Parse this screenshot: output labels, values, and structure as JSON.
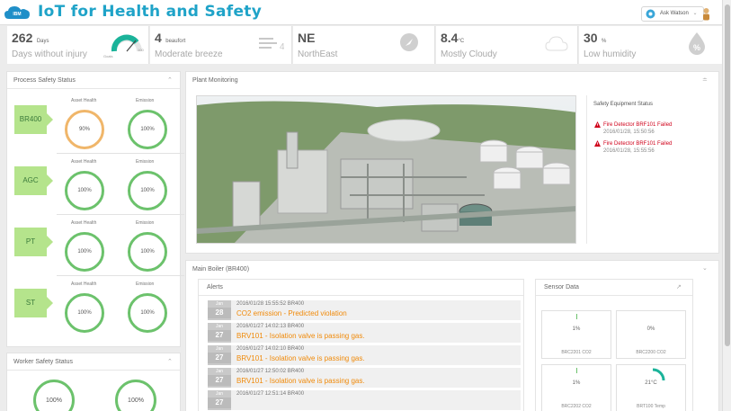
{
  "header": {
    "title": "IoT for Health and Safety",
    "logo_text": "IBM",
    "ask_watson": "Ask Watson"
  },
  "kpis": [
    {
      "value": "262",
      "unit": "Days",
      "label": "Days without injury",
      "icon": "gauge-icon",
      "gauge_max": "100",
      "gauge_label": "Goals"
    },
    {
      "value": "4",
      "unit": "beaufort",
      "label": "Moderate breeze",
      "icon": "wind-icon"
    },
    {
      "value": "NE",
      "unit": "",
      "label": "NorthEast",
      "icon": "compass-icon"
    },
    {
      "value": "8.4",
      "unit": "°C",
      "label": "Mostly Cloudy",
      "icon": "cloud-icon"
    },
    {
      "value": "30",
      "unit": "%",
      "label": "Low humidity",
      "icon": "humidity-icon"
    }
  ],
  "process_safety": {
    "title": "Process Safety Status",
    "col_asset": "Asset Health",
    "col_emission": "Emission",
    "rows": [
      {
        "unit": "BR400",
        "asset": "90%",
        "emission": "100%"
      },
      {
        "unit": "AGC",
        "asset": "100%",
        "emission": "100%"
      },
      {
        "unit": "PT",
        "asset": "100%",
        "emission": "100%"
      },
      {
        "unit": "ST",
        "asset": "100%",
        "emission": "100%"
      }
    ]
  },
  "worker_safety": {
    "title": "Worker Safety Status",
    "values": [
      "100%",
      "100%"
    ]
  },
  "plant": {
    "title": "Plant Monitoring",
    "safety_title": "Safety Equipment Status",
    "alarms": [
      {
        "title": "Fire Detector BRF101 Failed",
        "time": "2016/01/28, 15:50:56"
      },
      {
        "title": "Fire Detector BRF101 Failed",
        "time": "2016/01/28, 15:55:56"
      }
    ]
  },
  "boiler": {
    "title": "Main Boiler (BR400)",
    "alerts_title": "Alerts",
    "alerts": [
      {
        "month": "Jan",
        "day": "28",
        "meta": "2016/01/28 15:55:52   BR400",
        "text": "CO2 emission - Predicted violation"
      },
      {
        "month": "Jan",
        "day": "27",
        "meta": "2016/01/27 14:02:13   BR400",
        "text": "BRV101 - Isolation valve is passing gas."
      },
      {
        "month": "Jan",
        "day": "27",
        "meta": "2016/01/27 14:02:10   BR400",
        "text": "BRV101 - Isolation valve is passing gas."
      },
      {
        "month": "Jan",
        "day": "27",
        "meta": "2016/01/27 12:50:02   BR400",
        "text": "BRV101 - Isolation valve is passing gas."
      },
      {
        "month": "Jan",
        "day": "27",
        "meta": "2016/01/27 12:51:14   BR400",
        "text": ""
      }
    ],
    "sensor_title": "Sensor Data",
    "sensors": [
      {
        "value": "1%",
        "label": "BRC2201 CO2"
      },
      {
        "value": "0%",
        "label": "BRC2200 CO2"
      },
      {
        "value": "1%",
        "label": "BRC2202 CO2"
      },
      {
        "value": "21°C",
        "label": "BRT100 Temp"
      }
    ]
  },
  "colors": {
    "accent": "#1fa3c8",
    "ok": "#6cc26c",
    "warn": "#f0b66a",
    "alert": "#f08a0a",
    "error": "#d0021b"
  }
}
